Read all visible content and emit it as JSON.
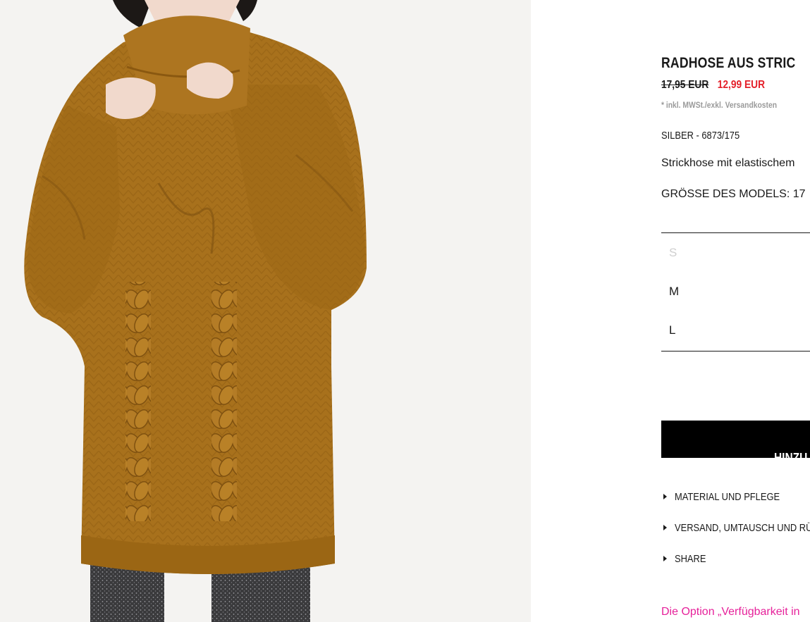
{
  "product": {
    "title": "RADHOSE AUS STRIC",
    "old_price": "17,95 EUR",
    "sale_price": "12,99 EUR",
    "tax_note": "* inkl. MWSt./exkl. Versandkosten",
    "color_ref": "SILBER - 6873/175",
    "description": "Strickhose mit elastischem",
    "model_size": "GRÖSSE DES MODELS: 17",
    "image_alt": "Model in oversized brown cable-knit turtleneck sweater"
  },
  "sizes": [
    {
      "label": "S",
      "available": false
    },
    {
      "label": "M",
      "available": true
    },
    {
      "label": "L",
      "available": true
    }
  ],
  "cart": {
    "add_label": "HINZU"
  },
  "accordion": [
    {
      "label": "MATERIAL UND PFLEGE"
    },
    {
      "label": "VERSAND, UMTAUSCH UND RÜ"
    },
    {
      "label": "SHARE"
    }
  ],
  "availability_note": "Die Option „Verfügbarkeit in",
  "colors": {
    "sale": "#e4202a",
    "availability_link": "#e6219a",
    "sweater": "#a8711c",
    "button_bg": "#000000"
  },
  "icons": {
    "accordion": "caret-right-icon"
  }
}
